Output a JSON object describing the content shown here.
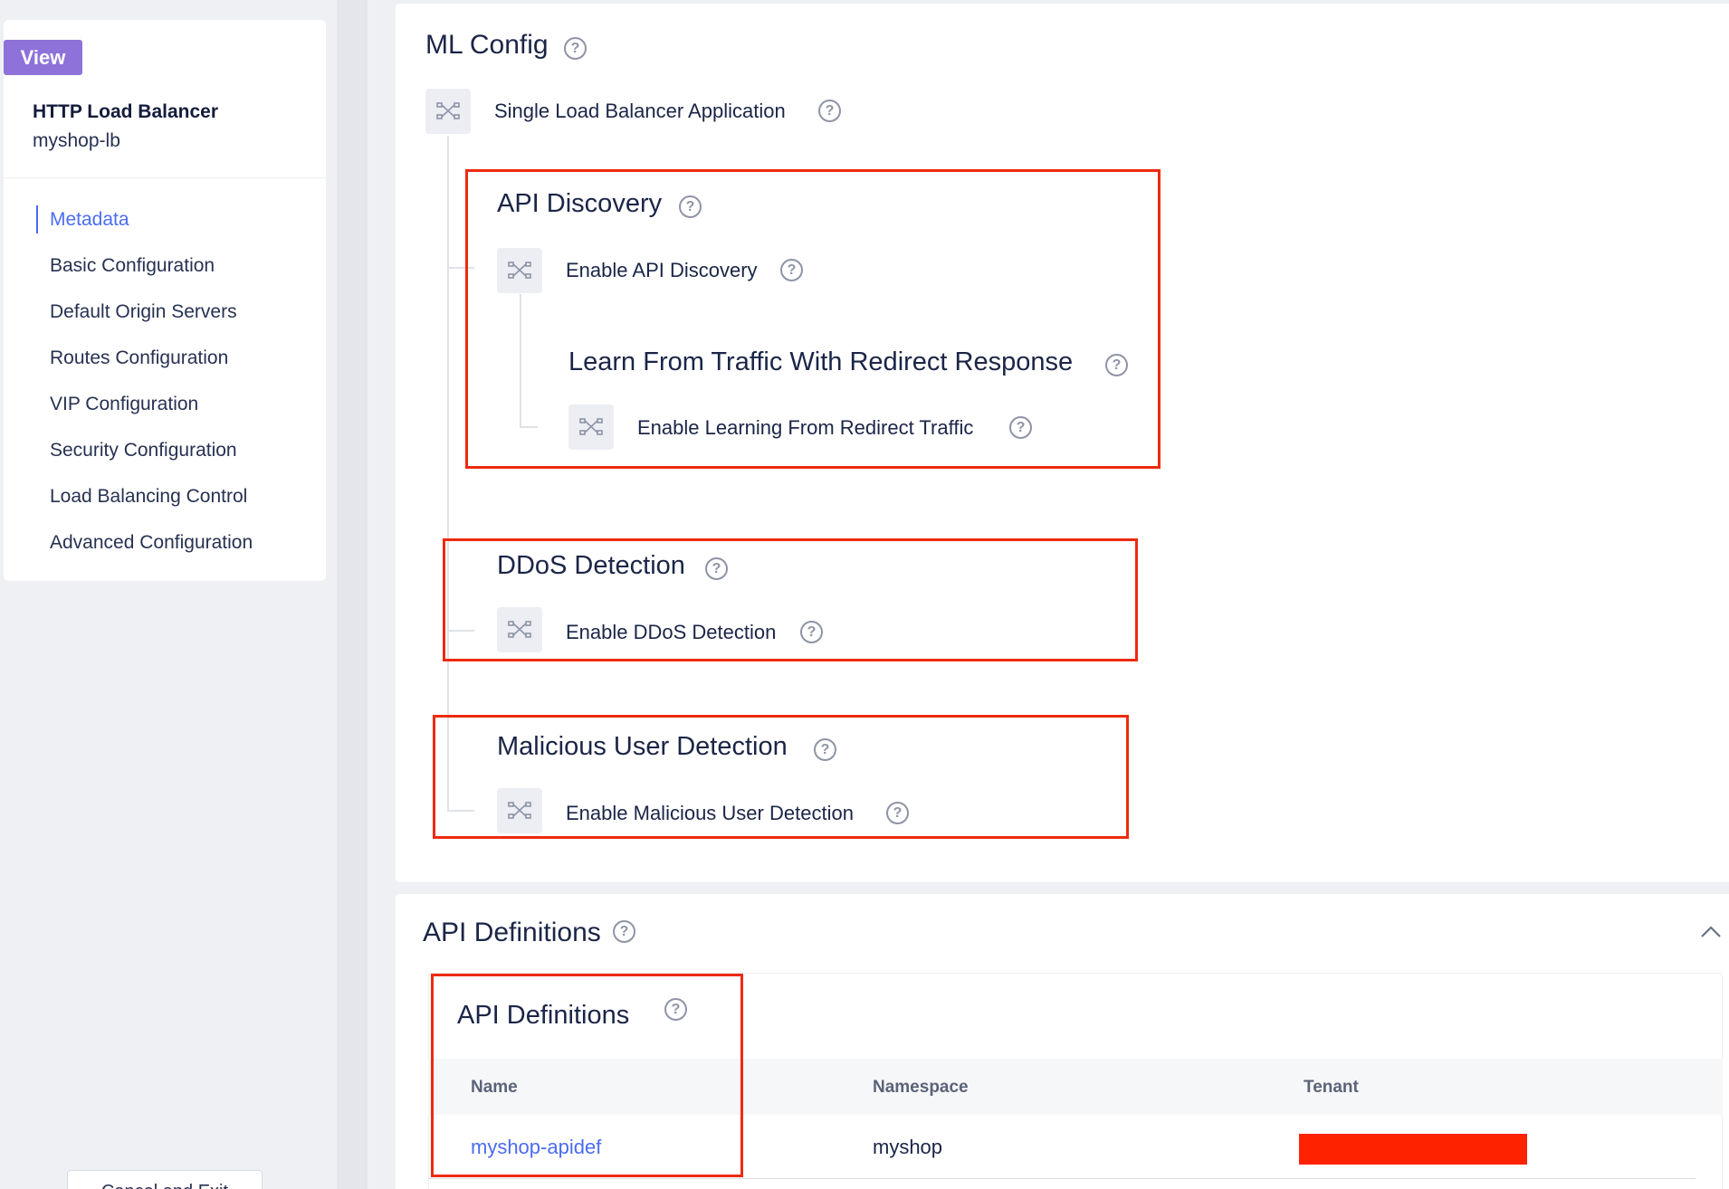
{
  "sidebar": {
    "view_badge": "View",
    "lb_type": "HTTP Load Balancer",
    "lb_name": "myshop-lb",
    "nav_items": [
      {
        "label": "Metadata",
        "active": true
      },
      {
        "label": "Basic Configuration",
        "active": false
      },
      {
        "label": "Default Origin Servers",
        "active": false
      },
      {
        "label": "Routes Configuration",
        "active": false
      },
      {
        "label": "VIP Configuration",
        "active": false
      },
      {
        "label": "Security Configuration",
        "active": false
      },
      {
        "label": "Load Balancing Control",
        "active": false
      },
      {
        "label": "Advanced Configuration",
        "active": false
      }
    ],
    "bottom_button": "Cancel and Exit"
  },
  "ml_config": {
    "title": "ML Config",
    "single_lb": "Single Load Balancer Application",
    "api_discovery": {
      "title": "API Discovery",
      "enable": "Enable API Discovery",
      "learn_title": "Learn From Traffic With Redirect Response",
      "learn_enable": "Enable Learning From Redirect Traffic"
    },
    "ddos": {
      "title": "DDoS Detection",
      "enable": "Enable DDoS Detection"
    },
    "malicious": {
      "title": "Malicious User Detection",
      "enable": "Enable Malicious User Detection"
    }
  },
  "api_definitions": {
    "section_title": "API Definitions",
    "table_title": "API Definitions",
    "columns": [
      "Name",
      "Namespace",
      "Tenant"
    ],
    "rows": [
      {
        "name": "myshop-apidef",
        "namespace": "myshop",
        "tenant": ""
      }
    ]
  },
  "colors": {
    "accent": "#4b6cf0",
    "badge": "#8e72d9",
    "highlight_box": "#ee2a0e",
    "redaction": "#ff2200"
  },
  "icons": {
    "help": "question-circle-icon",
    "node": "branch-node-icon",
    "collapse": "chevron-up-icon"
  }
}
